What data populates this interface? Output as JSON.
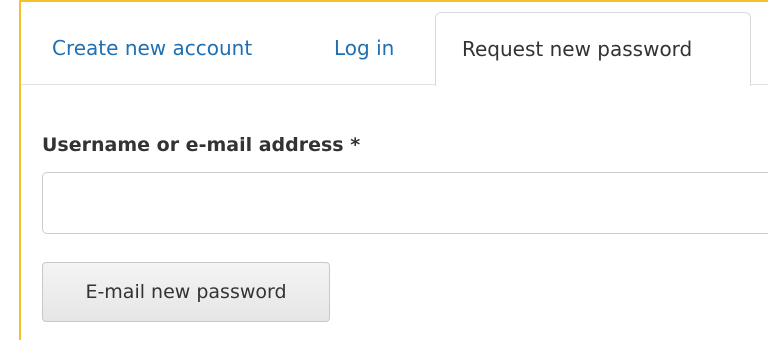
{
  "tabs": [
    {
      "label": "Create new account",
      "active": false
    },
    {
      "label": "Log in",
      "active": false
    },
    {
      "label": "Request new password",
      "active": true
    }
  ],
  "form": {
    "username_label": "Username or e-mail address *",
    "username_value": "",
    "submit_label": "E-mail new password"
  },
  "colors": {
    "frame_border": "#f3c22a",
    "link": "#1f6fb2",
    "text": "#333333"
  }
}
